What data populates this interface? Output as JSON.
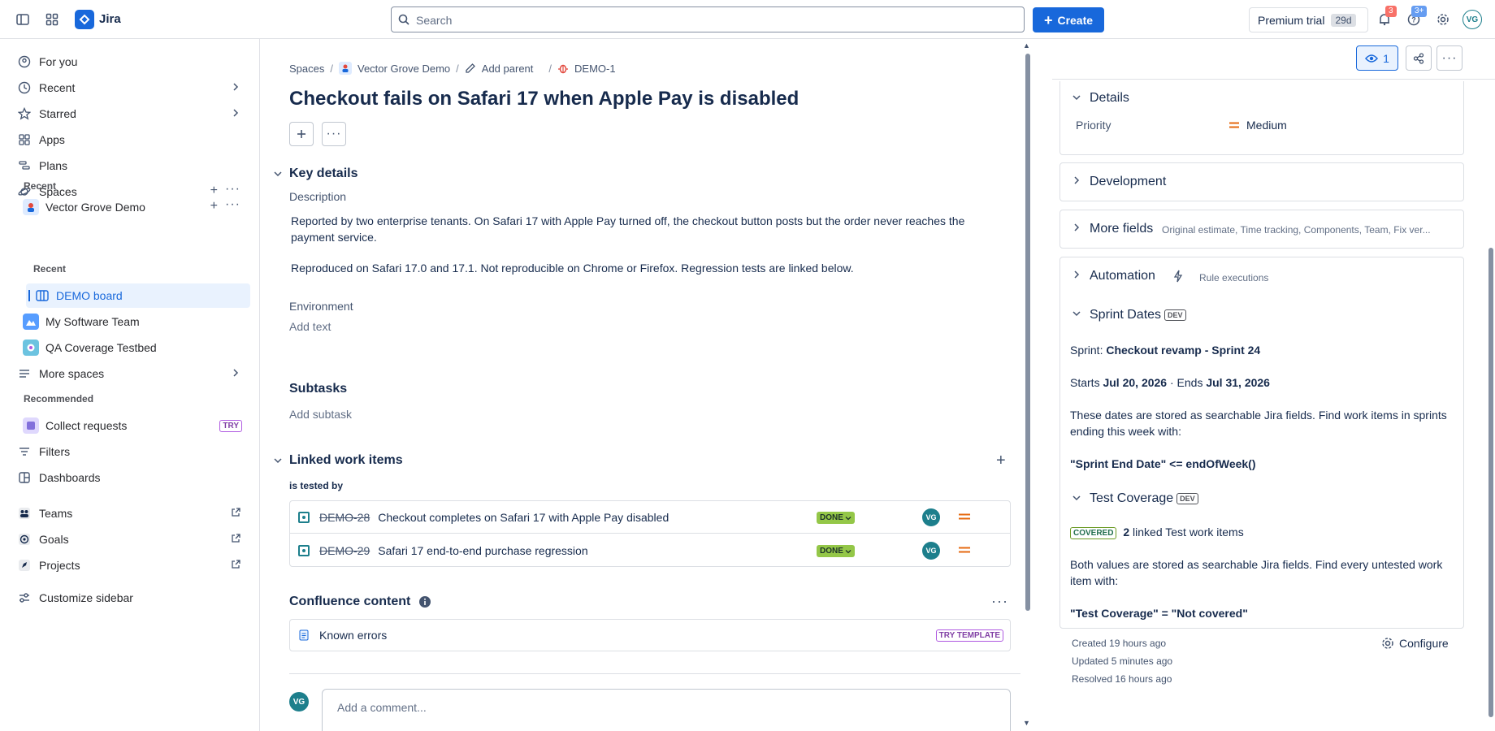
{
  "topbar": {
    "app_name": "Jira",
    "search_placeholder": "Search",
    "create_label": "Create",
    "premium_label": "Premium trial",
    "premium_days": "29d",
    "notifications_count": "3",
    "help_count": "3+",
    "user_initials": "VG"
  },
  "sidebar": {
    "for_you": "For you",
    "recent": "Recent",
    "starred": "Starred",
    "apps": "Apps",
    "plans": "Plans",
    "spaces": "Spaces",
    "recent_header": "Recent",
    "vector_grove": "Vector Grove Demo",
    "recent_sub": "Recent",
    "demo_board": "DEMO board",
    "my_software_team": "My Software Team",
    "qa_coverage": "QA Coverage Testbed",
    "more_spaces": "More spaces",
    "recommended_header": "Recommended",
    "collect_requests": "Collect requests",
    "try_badge": "TRY",
    "filters": "Filters",
    "dashboards": "Dashboards",
    "teams": "Teams",
    "goals": "Goals",
    "projects": "Projects",
    "customize": "Customize sidebar"
  },
  "breadcrumb": {
    "spaces": "Spaces",
    "project": "Vector Grove Demo",
    "add_parent": "Add parent",
    "issue_key": "DEMO-1"
  },
  "issue": {
    "title": "Checkout fails on Safari 17 when Apple Pay is disabled",
    "key_details": "Key details",
    "description_label": "Description",
    "description_p1": "Reported by two enterprise tenants. On Safari 17 with Apple Pay turned off, the checkout button posts but the order never reaches the payment service.",
    "description_p2": "Reproduced on Safari 17.0 and 17.1. Not reproducible on Chrome or Firefox. Regression tests are linked below.",
    "environment_label": "Environment",
    "environment_placeholder": "Add text",
    "subtasks_label": "Subtasks",
    "subtasks_placeholder": "Add subtask",
    "linked_label": "Linked work items",
    "link_type": "is tested by",
    "linked_items": [
      {
        "key": "DEMO-28",
        "summary": "Checkout completes on Safari 17 with Apple Pay disabled",
        "status": "DONE",
        "assignee": "VG"
      },
      {
        "key": "DEMO-29",
        "summary": "Safari 17 end-to-end purchase regression",
        "status": "DONE",
        "assignee": "VG"
      }
    ],
    "confluence_label": "Confluence content",
    "confluence_item": "Known errors",
    "try_template": "TRY TEMPLATE",
    "comment_placeholder": "Add a comment...",
    "commenter_initials": "VG"
  },
  "right_panel": {
    "watchers": "1",
    "details_label": "Details",
    "priority_label": "Priority",
    "priority_value": "Medium",
    "development_label": "Development",
    "more_fields_label": "More fields",
    "more_fields_hint": "Original estimate, Time tracking, Components, Team, Fix ver...",
    "automation_label": "Automation",
    "automation_hint": "Rule executions",
    "sprint_dates_label": "Sprint Dates",
    "dev_tag": "DEV",
    "sprint_prefix": "Sprint:",
    "sprint_name": "Checkout revamp - Sprint 24",
    "starts_prefix": "Starts",
    "start_date": "Jul 20, 2026",
    "ends_prefix": "· Ends",
    "end_date": "Jul 31, 2026",
    "sprint_note": "These dates are stored as searchable Jira fields. Find work items in sprints ending this week with:",
    "sprint_query": "\"Sprint End Date\" <= endOfWeek()",
    "test_coverage_label": "Test Coverage",
    "covered_badge": "COVERED",
    "linked_count": "2",
    "linked_count_text": "linked Test work items",
    "coverage_note": "Both values are stored as searchable Jira fields. Find every untested work item with:",
    "coverage_query": "\"Test Coverage\" = \"Not covered\"",
    "created": "Created 19 hours ago",
    "updated": "Updated 5 minutes ago",
    "resolved": "Resolved 16 hours ago",
    "configure": "Configure"
  },
  "colors": {
    "brand_blue": "#1868db",
    "done_green": "#94c748",
    "priority_orange": "#e56910",
    "avatar_teal": "#1d7f8c"
  }
}
